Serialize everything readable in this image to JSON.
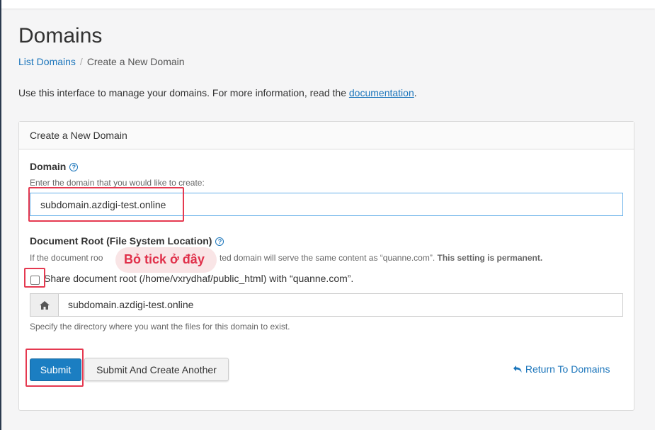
{
  "page": {
    "title": "Domains",
    "breadcrumb": {
      "link": "List Domains",
      "separator": "/",
      "current": "Create a New Domain"
    },
    "intro_prefix": "Use this interface to manage your domains. For more information, read the ",
    "intro_link": "documentation",
    "intro_suffix": "."
  },
  "panel": {
    "heading": "Create a New Domain",
    "domain": {
      "label": "Domain",
      "help": "Enter the domain that you would like to create:",
      "value": "subdomain.azdigi-test.online"
    },
    "docroot": {
      "label": "Document Root (File System Location)",
      "help_start": "If the document roo",
      "help_middle": "ted domain will serve the same content as “quanne.com”.",
      "help_bold": "This setting is permanent.",
      "share_label": "Share document root (/home/vxrydhaf/public_html) with “quanne.com”.",
      "share_checked": false,
      "path_value": "subdomain.azdigi-test.online",
      "path_help": "Specify the directory where you want the files for this domain to exist."
    },
    "buttons": {
      "submit": "Submit",
      "submit_another": "Submit And Create Another",
      "return": "Return To Domains"
    }
  },
  "annotation": {
    "text": "Bỏ tick ở đây",
    "color": "#e53950"
  },
  "colors": {
    "link": "#1b75bb",
    "primary_button": "#1b7ec2",
    "annotation": "#e53950"
  }
}
